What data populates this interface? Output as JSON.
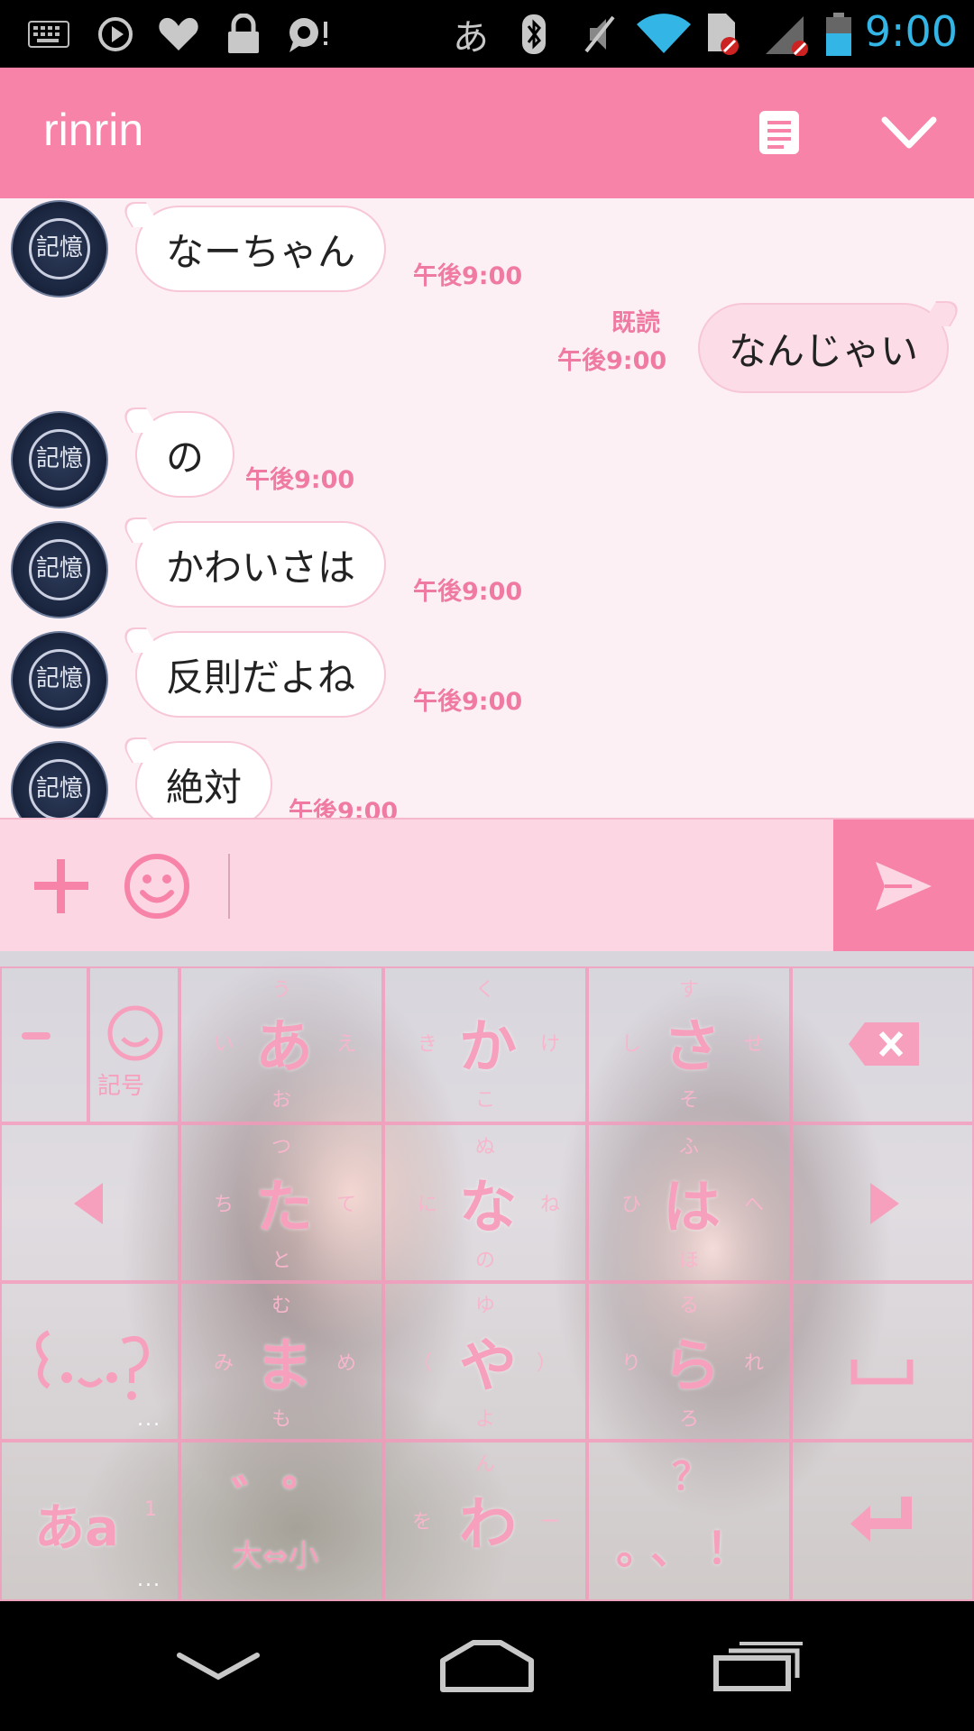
{
  "status_bar": {
    "time": "9:00",
    "ime_indicator": "あ",
    "icons": [
      "keyboard-icon",
      "play-icon",
      "heart-icon",
      "lock-icon",
      "chat-alert-icon",
      "bluetooth-icon",
      "mute-icon",
      "wifi-icon",
      "sim-icon",
      "signal-icon",
      "battery-icon"
    ],
    "time_color": "#33b5e5"
  },
  "header": {
    "title": "rinrin",
    "menu_icon": "note-icon",
    "collapse_icon": "chevron-down-icon",
    "color": "#f783a9"
  },
  "messages": [
    {
      "direction": "in",
      "text": "なーちゃん",
      "time": "午後9:00"
    },
    {
      "direction": "out",
      "text": "なんじゃい",
      "time": "午後9:00",
      "read_label": "既読"
    },
    {
      "direction": "in",
      "text": "の",
      "time": "午後9:00"
    },
    {
      "direction": "in",
      "text": "かわいさは",
      "time": "午後9:00"
    },
    {
      "direction": "in",
      "text": "反則だよね",
      "time": "午後9:00"
    },
    {
      "direction": "in",
      "text": "絶対",
      "time": "午後9:00"
    }
  ],
  "avatar": {
    "label": "記憶"
  },
  "input_bar": {
    "value": "",
    "plus_icon": "plus-icon",
    "emoji_icon": "smiley-icon",
    "send_icon": "send-icon"
  },
  "keyboard": {
    "keys": {
      "a": {
        "main": "あ",
        "up": "う",
        "left": "い",
        "right": "え",
        "down": "お"
      },
      "ka": {
        "main": "か",
        "up": "く",
        "left": "き",
        "right": "け",
        "down": "こ"
      },
      "sa": {
        "main": "さ",
        "up": "す",
        "left": "し",
        "right": "せ",
        "down": "そ"
      },
      "ta": {
        "main": "た",
        "up": "つ",
        "left": "ち",
        "right": "て",
        "down": "と"
      },
      "na": {
        "main": "な",
        "up": "ぬ",
        "left": "に",
        "right": "ね",
        "down": "の"
      },
      "ha": {
        "main": "は",
        "up": "ふ",
        "left": "ひ",
        "right": "へ",
        "down": "ほ"
      },
      "ma": {
        "main": "ま",
        "up": "む",
        "left": "み",
        "right": "め",
        "down": "も"
      },
      "ya": {
        "main": "や",
        "up": "ゆ",
        "left": "（",
        "right": "）",
        "down": "よ"
      },
      "ra": {
        "main": "ら",
        "up": "る",
        "left": "り",
        "right": "れ",
        "down": "ろ"
      },
      "wa": {
        "main": "わ",
        "up": "ん",
        "left": "を",
        "right": "ー",
        "down": ""
      },
      "dakuten": {
        "main": "゛゜",
        "sub": "大⇔小"
      },
      "punct": {
        "main": "。、！",
        "up": "？"
      },
      "mode": {
        "main": "あa",
        "sub": "1"
      },
      "kigou": {
        "label": "記号"
      }
    },
    "dots_label": "..."
  },
  "nav_bar": {
    "icons": [
      "back-icon",
      "home-icon",
      "recents-icon"
    ]
  }
}
